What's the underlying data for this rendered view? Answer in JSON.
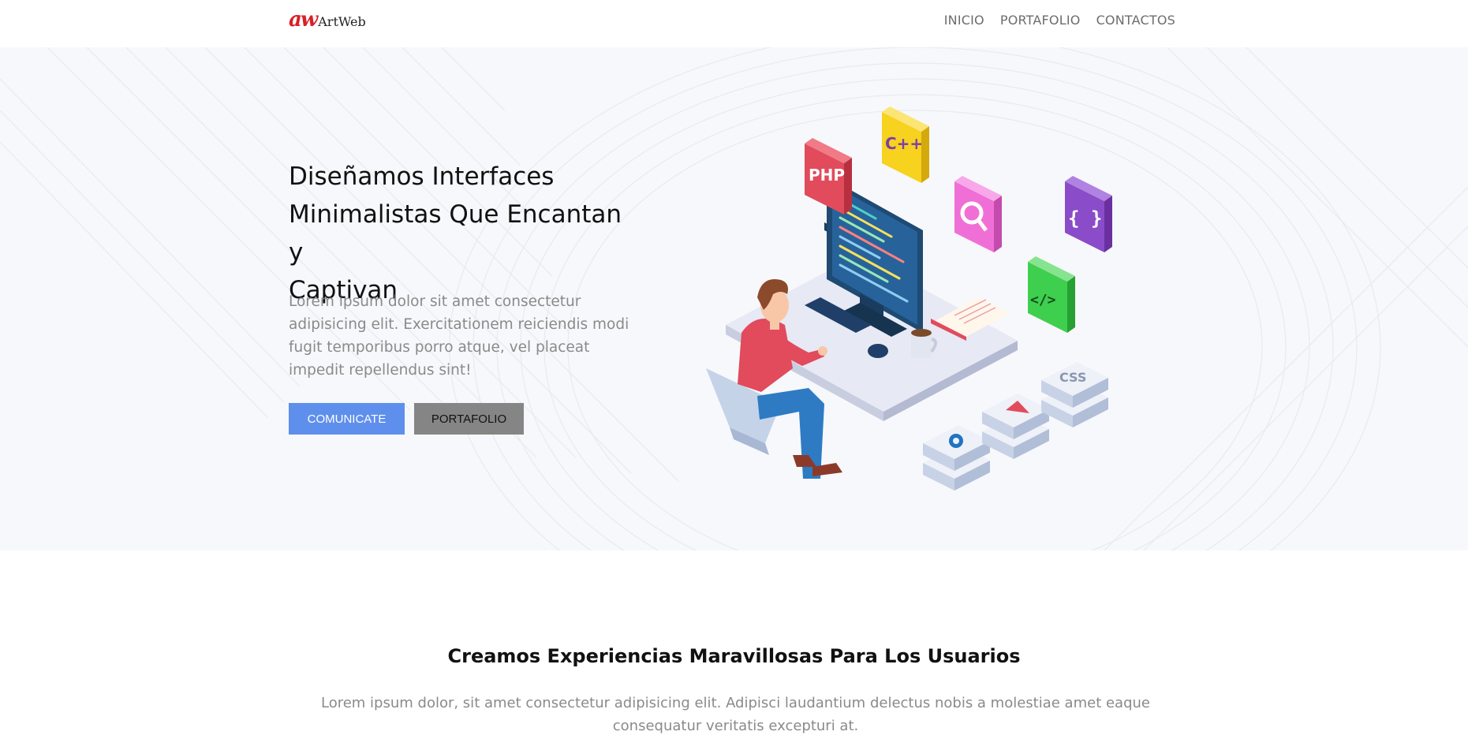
{
  "brand": {
    "mark": "aw",
    "name": "ArtWeb"
  },
  "nav": {
    "items": [
      "INICIO",
      "PORTAFOLIO",
      "CONTACTOS"
    ]
  },
  "hero": {
    "title_line1": "Diseñamos Interfaces",
    "title_line2": "Minimalistas Que Encantan y",
    "title_line3": "Captivan",
    "text": "Lorem ipsum dolor sit amet consectetur adipisicing elit. Exercitationem reiciendis modi fugit temporibus porro atque, vel placeat impedit repellendus sint!",
    "primary_button": "COMUNICATE",
    "secondary_button": "PORTAFOLIO",
    "illustration_labels": {
      "php": "PHP",
      "cpp": "C++",
      "css": "CSS",
      "braces": "{ }",
      "code": "</>"
    }
  },
  "section2": {
    "title": "Creamos Experiencias Maravillosas Para Los Usuarios",
    "text": "Lorem ipsum dolor, sit amet consectetur adipisicing elit. Adipisci laudantium delectus nobis a molestiae amet eaque consequatur veritatis excepturi at."
  },
  "colors": {
    "accent": "#5f8fec",
    "brand_red": "#d92027",
    "hero_bg": "#f7f8fb"
  }
}
